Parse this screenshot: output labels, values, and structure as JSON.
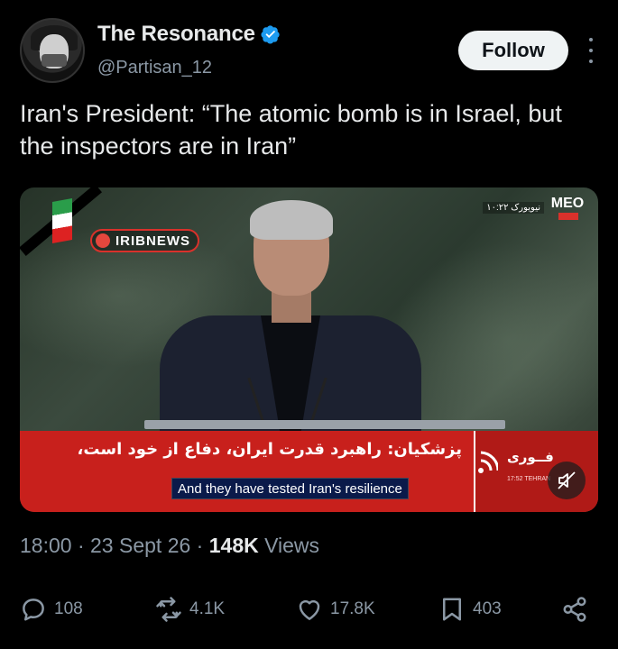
{
  "author": {
    "display_name": "The Resonance",
    "handle": "@Partisan_12",
    "verified": true
  },
  "follow_label": "Follow",
  "tweet": {
    "text": "Iran's President: “The atomic bomb is in Israel, but the inspectors are in Iran”"
  },
  "media": {
    "channel_logo": "IRIBNEWS",
    "corner_logo": "MEO",
    "timestamp_overlay": "نیویورک ۱۰:۲۲",
    "persian_headline": "پزشکیان: راهبرد قدرت ایران، دفاع از خود است،",
    "caption": "And they have tested Iran's resilience",
    "breaking_label": "فــوری",
    "breaking_time": "17:52 TEHRAN",
    "mute_icon": "muted-speaker-icon"
  },
  "meta": {
    "time": "18:00",
    "sep1": " · ",
    "date": "23 Sept 26",
    "sep2": " · ",
    "views_count": "148K",
    "views_label": " Views"
  },
  "stats": {
    "replies": "108",
    "reposts": "4.1K",
    "likes": "17.8K",
    "bookmarks": "403"
  },
  "colors": {
    "background": "#000000",
    "verified": "#1d9bf0",
    "muted_text": "#8b98a5",
    "banner_red": "#c8201c"
  }
}
